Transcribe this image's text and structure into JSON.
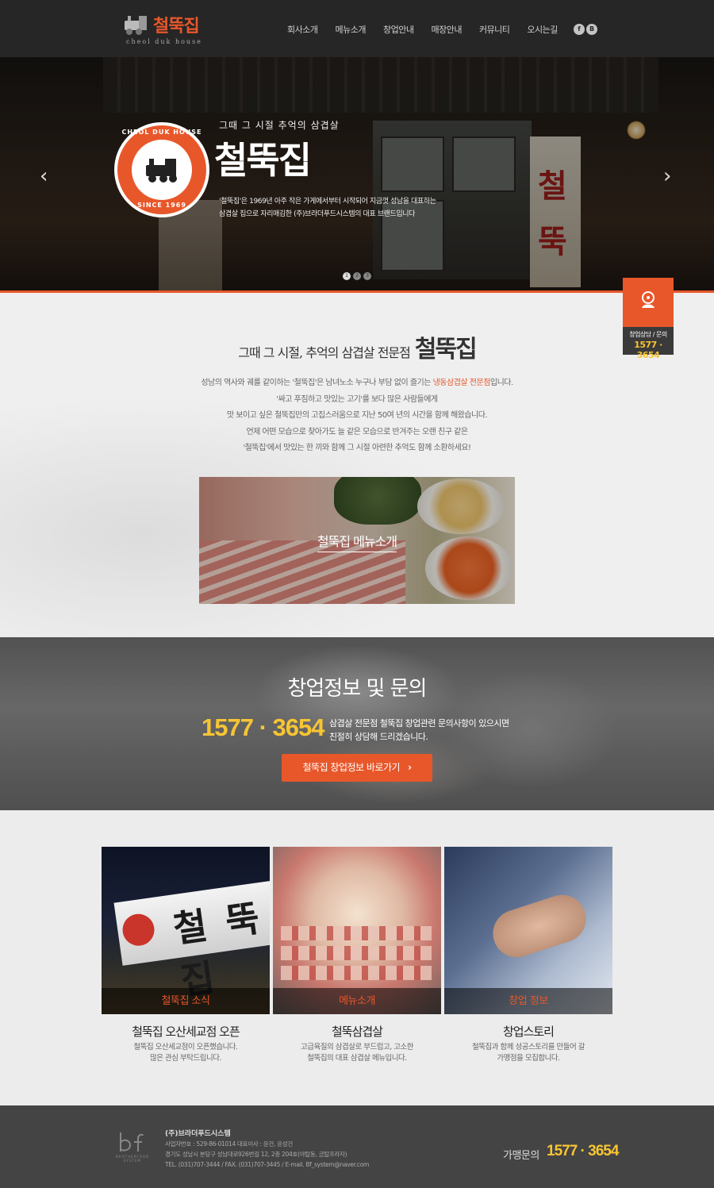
{
  "header": {
    "logo_text": "철뚝집",
    "logo_sub": "cheol duk house",
    "nav": [
      "회사소개",
      "메뉴소개",
      "창업안내",
      "매장안내",
      "커뮤니티",
      "오시는길"
    ],
    "sns": [
      "f",
      "B"
    ]
  },
  "hero": {
    "badge_top": "CHEOL DUK HOUSE",
    "badge_bottom": "SINCE 1969",
    "tagline": "그때 그 시절 추억의 삼겹살",
    "title": "철뚝집",
    "desc_line1": "'철뚝집'은 1969년 아주 작은 가게에서부터 시작되어 지금껏 성남을 대표하는",
    "desc_line2": "삼겹살 집으로 자리매김한 (주)브라더푸드시스템의 대표 브랜드입니다",
    "sign_chars": [
      "철",
      "뚝"
    ],
    "arrow_prev": "‹",
    "arrow_next": "›",
    "dots": [
      "1",
      "2",
      "3"
    ],
    "active_slide": 1
  },
  "quick": {
    "label": "창업상담 / 문의",
    "number": "1577 · 3654"
  },
  "intro": {
    "title_small": "그때 그 시절, 추억의 삼겹살 전문점",
    "title_large": "철뚝집",
    "line1_pre": "성남의 역사와 궤를 같이하는 '철뚝집'은 남녀노소 누구나 부담 없이 즐기는 ",
    "line1_hl": "냉동삼겹살 전문점",
    "line1_post": "입니다.",
    "line2": "'싸고 푸짐하고 맛있는 고기'를 보다 많은 사람들에게",
    "line3": "맛 보이고 싶은 철뚝집만의 고집스러움으로 지난 50여 년의 시간을 함께 해왔습니다.",
    "line4": "언제 어떤 모습으로 찾아가도 늘 같은 모습으로 반겨주는 오랜 친구 같은",
    "line5": "'철뚝집'에서 맛있는 한 끼와 함께 그 시절 아련한 추억도 함께 소환하세요!",
    "banner_label": "철뚝집 메뉴소개"
  },
  "franchise": {
    "title": "창업정보 및 문의",
    "number": "1577 · 3654",
    "desc_line1": "삼겹살 전문점 철뚝집 창업관련 문의사항이 있으시면",
    "desc_line2": "친절히 상담해 드리겠습니다.",
    "button": "철뚝집 창업정보 바로가기",
    "button_chevron": "›"
  },
  "cards": [
    {
      "caption": "철뚝집 소식",
      "title": "철뚝집 오산세교점 오픈",
      "desc1": "철뚝집 오산세교점이 오픈했습니다.",
      "desc2": "많은 관심 부탁드립니다.",
      "sign_text": "철 뚝 집"
    },
    {
      "caption": "메뉴소개",
      "title": "철뚝삼겹살",
      "desc1": "고급육질의 삼겹살로 부드럽고, 고소한",
      "desc2": "철뚝집의 대표 삼겹살 메뉴입니다."
    },
    {
      "caption": "창업 정보",
      "title": "창업스토리",
      "desc1": "철뚝집과 함께 성공스토리를 만들어 갈",
      "desc2": "가맹점을 모집합니다."
    }
  ],
  "footer": {
    "logo_text": "BROTHERFOOD SYSTEM",
    "company": "(주)브라더푸드시스템",
    "info1": "사업자번호 : 529-86-01014 대표이사 : 윤건, 윤성건",
    "info2": "경기도 성남시 분당구 성남대로926번길 12, 2층 204호(야탑동, 금탑프라자)",
    "info3": "TEL. (031)707-3444 / FAX. (031)707-3445 / E-mail. Bf_system@naver.com",
    "tel_label": "가맹문의",
    "tel": "1577 · 3654"
  },
  "colors": {
    "accent": "#e8572a",
    "highlight_number": "#f7c533",
    "header_bg": "#262626",
    "footer_bg": "#444444"
  }
}
